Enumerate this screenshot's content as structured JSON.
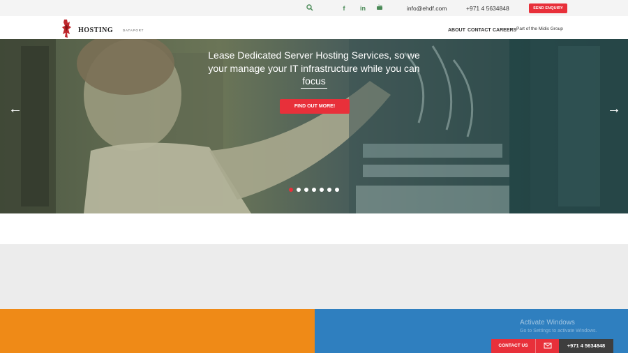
{
  "topbar": {
    "email": "info@ehdf.com",
    "phone": "+971 4 5634848",
    "enquiry_label": "SEND ENQUIRY",
    "icons": [
      "search-icon",
      "facebook-icon",
      "linkedin-icon",
      "youtube-icon"
    ]
  },
  "brand": {
    "name": "HOSTING",
    "sub": "DATAPORT"
  },
  "nav": {
    "items": [
      "ABOUT",
      "CONTACT",
      "CAREERS"
    ],
    "group_text": "Part of the Midis Group"
  },
  "hero": {
    "headline_line1": "Lease Dedicated Server Hosting Services, so we",
    "headline_line2": "your manage your IT infrastructure while you can",
    "headline_line3": "focus",
    "cta_label": "FIND OUT MORE!",
    "prev_arrow": "←",
    "next_arrow": "→",
    "slides_total": 7,
    "active_slide": 1
  },
  "watermark": {
    "title": "Activate Windows",
    "subtitle": "Go to Settings to activate Windows."
  },
  "floating": {
    "contact_label": "CONTACT US",
    "mail_icon": "mail-icon",
    "phone": "+971 4 5634848"
  },
  "colors": {
    "accent_red": "#e8303a",
    "orange": "#ef8a17",
    "blue": "#2f7fbf",
    "icon_green": "#4a8a57"
  }
}
